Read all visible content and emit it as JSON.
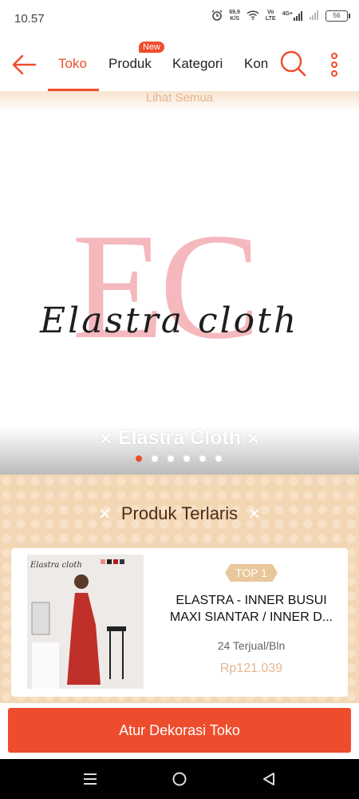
{
  "status_bar": {
    "time": "10.57",
    "net_speed_value": "69,9",
    "net_speed_unit": "K/S",
    "volte_top": "Vo",
    "volte_bottom": "LTE",
    "signal_label": "4G+",
    "battery": "56"
  },
  "nav": {
    "tabs": [
      {
        "label": "Toko"
      },
      {
        "label": "Produk"
      },
      {
        "label": "Kategori"
      },
      {
        "label": "Kon"
      }
    ],
    "new_badge": "New"
  },
  "banner": {
    "lihat_semua": "Lihat Semua",
    "logo_letters": {
      "e": "E",
      "c": "C"
    },
    "brand_script": "Elastra cloth",
    "store_name": "Elastra Cloth",
    "carousel": {
      "total": 6,
      "active_index": 0
    }
  },
  "section": {
    "title": "Produk Terlaris"
  },
  "product": {
    "rank_badge": "TOP 1",
    "name": "ELASTRA - INNER BUSUI MAXI SIANTAR / INNER D...",
    "sold": "24 Terjual/Bln",
    "price": "Rp121.039",
    "image_brand": "Elastra cloth"
  },
  "action": {
    "label": "Atur Dekorasi Toko"
  },
  "colors": {
    "accent": "#ee4d2d",
    "section_bg": "#f3d7b5",
    "price": "#e8b58f"
  }
}
